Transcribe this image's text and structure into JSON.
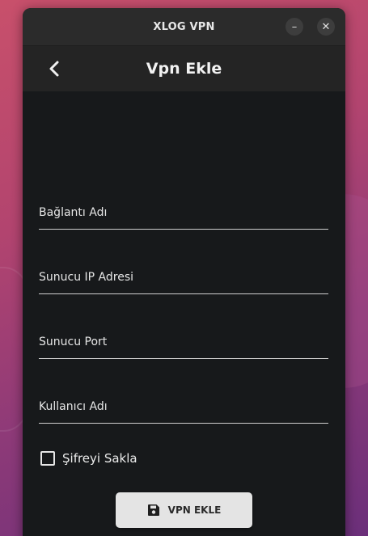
{
  "window": {
    "title": "XLOG VPN",
    "minimize_icon": "minimize-icon",
    "close_icon": "close-icon",
    "minimize_glyph": "–",
    "close_glyph": "✕"
  },
  "appbar": {
    "back_icon": "chevron-left-icon",
    "title": "Vpn Ekle"
  },
  "form": {
    "fields": [
      {
        "placeholder": "Bağlantı Adı",
        "value": ""
      },
      {
        "placeholder": "Sunucu IP Adresi",
        "value": ""
      },
      {
        "placeholder": "Sunucu Port",
        "value": ""
      },
      {
        "placeholder": "Kullanıcı Adı",
        "value": ""
      }
    ],
    "hide_password": {
      "label": "Şifreyi Sakla",
      "checked": false
    },
    "submit": {
      "icon": "save-icon",
      "label": "VPN EKLE"
    }
  },
  "colors": {
    "window_bg": "#17191b",
    "titlebar_bg": "#2b2b2b",
    "appbar_bg": "#242424",
    "button_bg": "#e4e4e4",
    "text": "#e6e6e6"
  }
}
